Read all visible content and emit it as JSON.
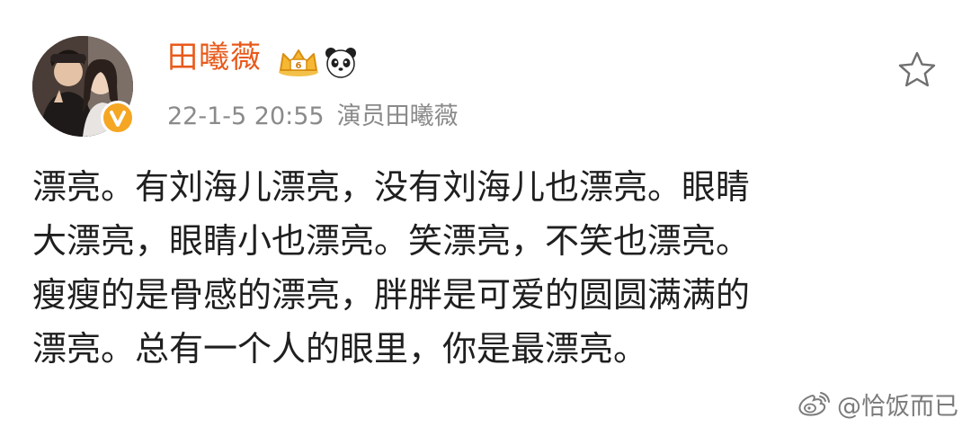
{
  "post": {
    "author": {
      "name": "田曦薇",
      "avatar_icon": "avatar-photo",
      "verified_icon": "verified-badge-icon",
      "badges": [
        "crown-icon",
        "panda-icon"
      ]
    },
    "timestamp": "22-1-5 20:55",
    "source": "演员田曦薇",
    "favorite_icon": "star-outline-icon",
    "body_lines": [
      "漂亮。有刘海儿漂亮，没有刘海儿也漂亮。眼睛",
      "大漂亮，眼睛小也漂亮。笑漂亮，不笑也漂亮。",
      "瘦瘦的是骨感的漂亮，胖胖是可爱的圆圆满满的",
      "漂亮。总有一个人的眼里，你是最漂亮。"
    ]
  },
  "watermark": {
    "text": "@恰饭而已",
    "icon": "weibo-logo-icon"
  },
  "colors": {
    "author_name": "#e85a1b",
    "meta_text": "#8a8a8a",
    "body_text": "#1f1f1f",
    "verified_badge": "#f5a623",
    "watermark": "#7b7b7b"
  }
}
